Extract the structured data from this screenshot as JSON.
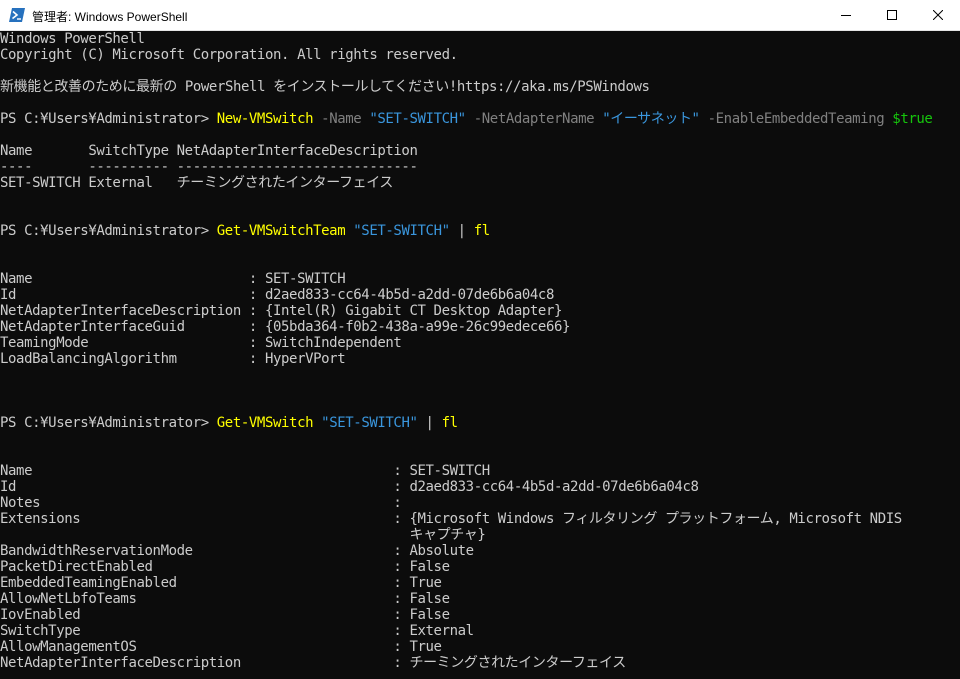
{
  "window": {
    "title": "管理者: Windows PowerShell",
    "icon": "powershell-icon",
    "controls": [
      "minimize-icon",
      "maximize-icon",
      "close-icon"
    ]
  },
  "colors": {
    "background": "#0C0C0C",
    "text": "#CCCCCC",
    "command": "#FFFF00",
    "parameter": "#808080",
    "string": "#3A96DD",
    "variable": "#16C60C"
  },
  "console": {
    "banner": [
      "Windows PowerShell",
      "Copyright (C) Microsoft Corporation. All rights reserved."
    ],
    "notice": "新機能と改善のために最新の PowerShell をインストールしてください!https://aka.ms/PSWindows",
    "cmd1": {
      "prompt": "PS C:¥Users¥Administrator> ",
      "command": "New-VMSwitch",
      "tokens": [
        " -Name ",
        "\"SET-SWITCH\"",
        " -NetAdapterName ",
        "\"イーサネット\"",
        " -EnableEmbeddedTeaming ",
        "$true"
      ]
    },
    "table1": {
      "header": "Name       SwitchType NetAdapterInterfaceDescription",
      "divider": "----       ---------- ------------------------------",
      "row": "SET-SWITCH External   チーミングされたインターフェイス"
    },
    "cmd2": {
      "prompt": "PS C:¥Users¥Administrator> ",
      "command": "Get-VMSwitchTeam",
      "tokens": [
        " ",
        "\"SET-SWITCH\"",
        " | ",
        "fl"
      ]
    },
    "team": [
      "Name                           : SET-SWITCH",
      "Id                             : d2aed833-cc64-4b5d-a2dd-07de6b6a04c8",
      "NetAdapterInterfaceDescription : {Intel(R) Gigabit CT Desktop Adapter}",
      "NetAdapterInterfaceGuid        : {05bda364-f0b2-438a-a99e-26c99edece66}",
      "TeamingMode                    : SwitchIndependent",
      "LoadBalancingAlgorithm         : HyperVPort"
    ],
    "cmd3": {
      "prompt": "PS C:¥Users¥Administrator> ",
      "command": "Get-VMSwitch",
      "tokens": [
        " ",
        "\"SET-SWITCH\"",
        " | ",
        "fl"
      ]
    },
    "switch": [
      "Name                                             : SET-SWITCH",
      "Id                                               : d2aed833-cc64-4b5d-a2dd-07de6b6a04c8",
      "Notes                                            :",
      "Extensions                                       : {Microsoft Windows フィルタリング プラットフォーム, Microsoft NDIS",
      "                                                   キャプチャ}",
      "BandwidthReservationMode                         : Absolute",
      "PacketDirectEnabled                              : False",
      "EmbeddedTeamingEnabled                           : True",
      "AllowNetLbfoTeams                                : False",
      "IovEnabled                                       : False",
      "SwitchType                                       : External",
      "AllowManagementOS                                : True",
      "NetAdapterInterfaceDescription                   : チーミングされたインターフェイス"
    ]
  }
}
